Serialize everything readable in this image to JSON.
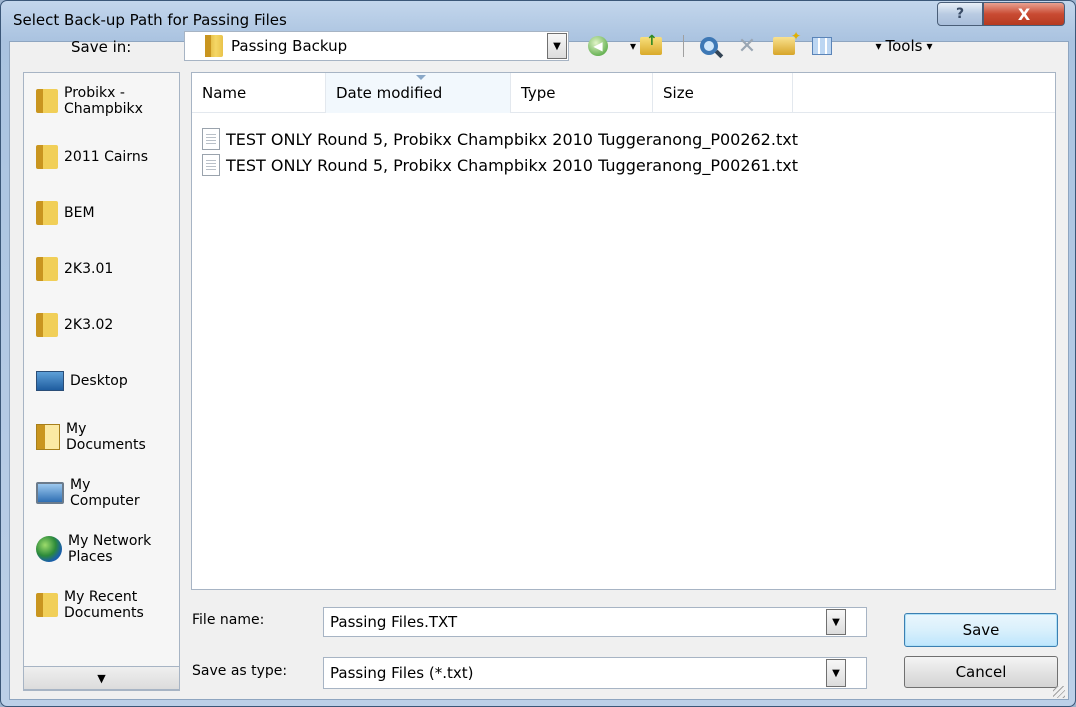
{
  "window": {
    "title": "Select Back-up Path for Passing Files",
    "help_glyph": "?",
    "close_glyph": "X"
  },
  "toolbar": {
    "save_in_label": "Save in:",
    "save_in_value": "Passing Backup",
    "tools_label": "Tools",
    "dropdown_glyph": "▼",
    "small_dropdown_glyph": "▾"
  },
  "places": [
    {
      "label": "Probikx - Champbikx",
      "icon": "folder-icon"
    },
    {
      "label": "2011 Cairns",
      "icon": "folder-icon"
    },
    {
      "label": "BEM",
      "icon": "folder-icon"
    },
    {
      "label": "2K3.01",
      "icon": "folder-icon"
    },
    {
      "label": "2K3.02",
      "icon": "folder-icon"
    },
    {
      "label": "Desktop",
      "icon": "desktop-icon"
    },
    {
      "label": "My Documents",
      "icon": "my-documents-icon"
    },
    {
      "label": "My Computer",
      "icon": "my-computer-icon"
    },
    {
      "label": "My Network Places",
      "icon": "network-places-icon"
    },
    {
      "label": "My Recent Documents",
      "icon": "folder-icon"
    }
  ],
  "places_scroll_glyph": "▼",
  "filelist": {
    "columns": [
      "Name",
      "Date modified",
      "Type",
      "Size"
    ],
    "files": [
      {
        "name": "TEST ONLY Round 5, Probikx Champbikx 2010 Tuggeranong_P00262.txt",
        "icon": "text-file-icon"
      },
      {
        "name": "TEST ONLY Round 5, Probikx Champbikx 2010 Tuggeranong_P00261.txt",
        "icon": "text-file-icon"
      }
    ]
  },
  "bottom": {
    "file_name_label": "File name:",
    "file_name_value": "Passing Files.TXT",
    "save_as_type_label": "Save as type:",
    "save_as_type_value": "Passing Files (*.txt)",
    "save_button": "Save",
    "cancel_button": "Cancel"
  },
  "colors": {
    "title_bar": "#aac3e0",
    "close_button": "#c94b33",
    "dialog_background": "#f0f0f0"
  }
}
